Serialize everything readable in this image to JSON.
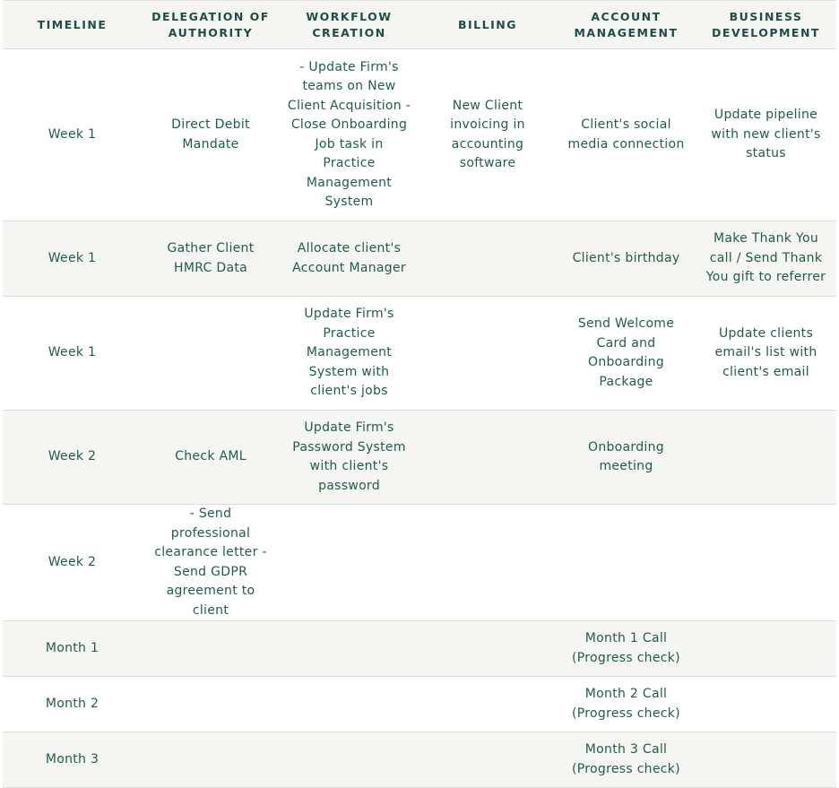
{
  "headers": [
    "TIMELINE",
    "DELEGATION OF\nAUTHORITY",
    "WORKFLOW\nCREATION",
    "BILLING",
    "ACCOUNT\nMANAGEMENT",
    "BUSINESS\nDEVELOPMENT"
  ],
  "rows": [
    [
      "Week 1",
      "Direct Debit\nMandate",
      "- Update Firm's\nteams on New\nClient Acquisition -\nClose Onboarding\nJob task in\nPractice\nManagement\nSystem",
      "New Client\ninvoicing in\naccounting\nsoftware",
      "Client's social\nmedia connection",
      "Update pipeline\nwith new client's\nstatus"
    ],
    [
      "Week 1",
      "Gather Client\nHMRC Data",
      "Allocate client's\nAccount Manager",
      "",
      "Client's birthday",
      "Make Thank You\ncall / Send Thank\nYou gift to referrer"
    ],
    [
      "Week 1",
      "",
      "Update Firm's\nPractice\nManagement\nSystem with\nclient's jobs",
      "",
      "Send Welcome\nCard and\nOnboarding\nPackage",
      "Update clients\nemail's list with\nclient's email"
    ],
    [
      "Week 2",
      "Check AML",
      "Update Firm's\nPassword System\nwith client's\npassword",
      "",
      "Onboarding\nmeeting",
      ""
    ],
    [
      "Week 2",
      "- Send professional\nclearance letter -\nSend GDPR\nagreement to client",
      "",
      "",
      "",
      ""
    ],
    [
      "Month 1",
      "",
      "",
      "",
      "Month 1 Call\n(Progress check)",
      ""
    ],
    [
      "Month 2",
      "",
      "",
      "",
      "Month 2 Call\n(Progress check)",
      ""
    ],
    [
      "Month 3",
      "",
      "",
      "",
      "Month 3 Call\n(Progress check)",
      ""
    ]
  ]
}
